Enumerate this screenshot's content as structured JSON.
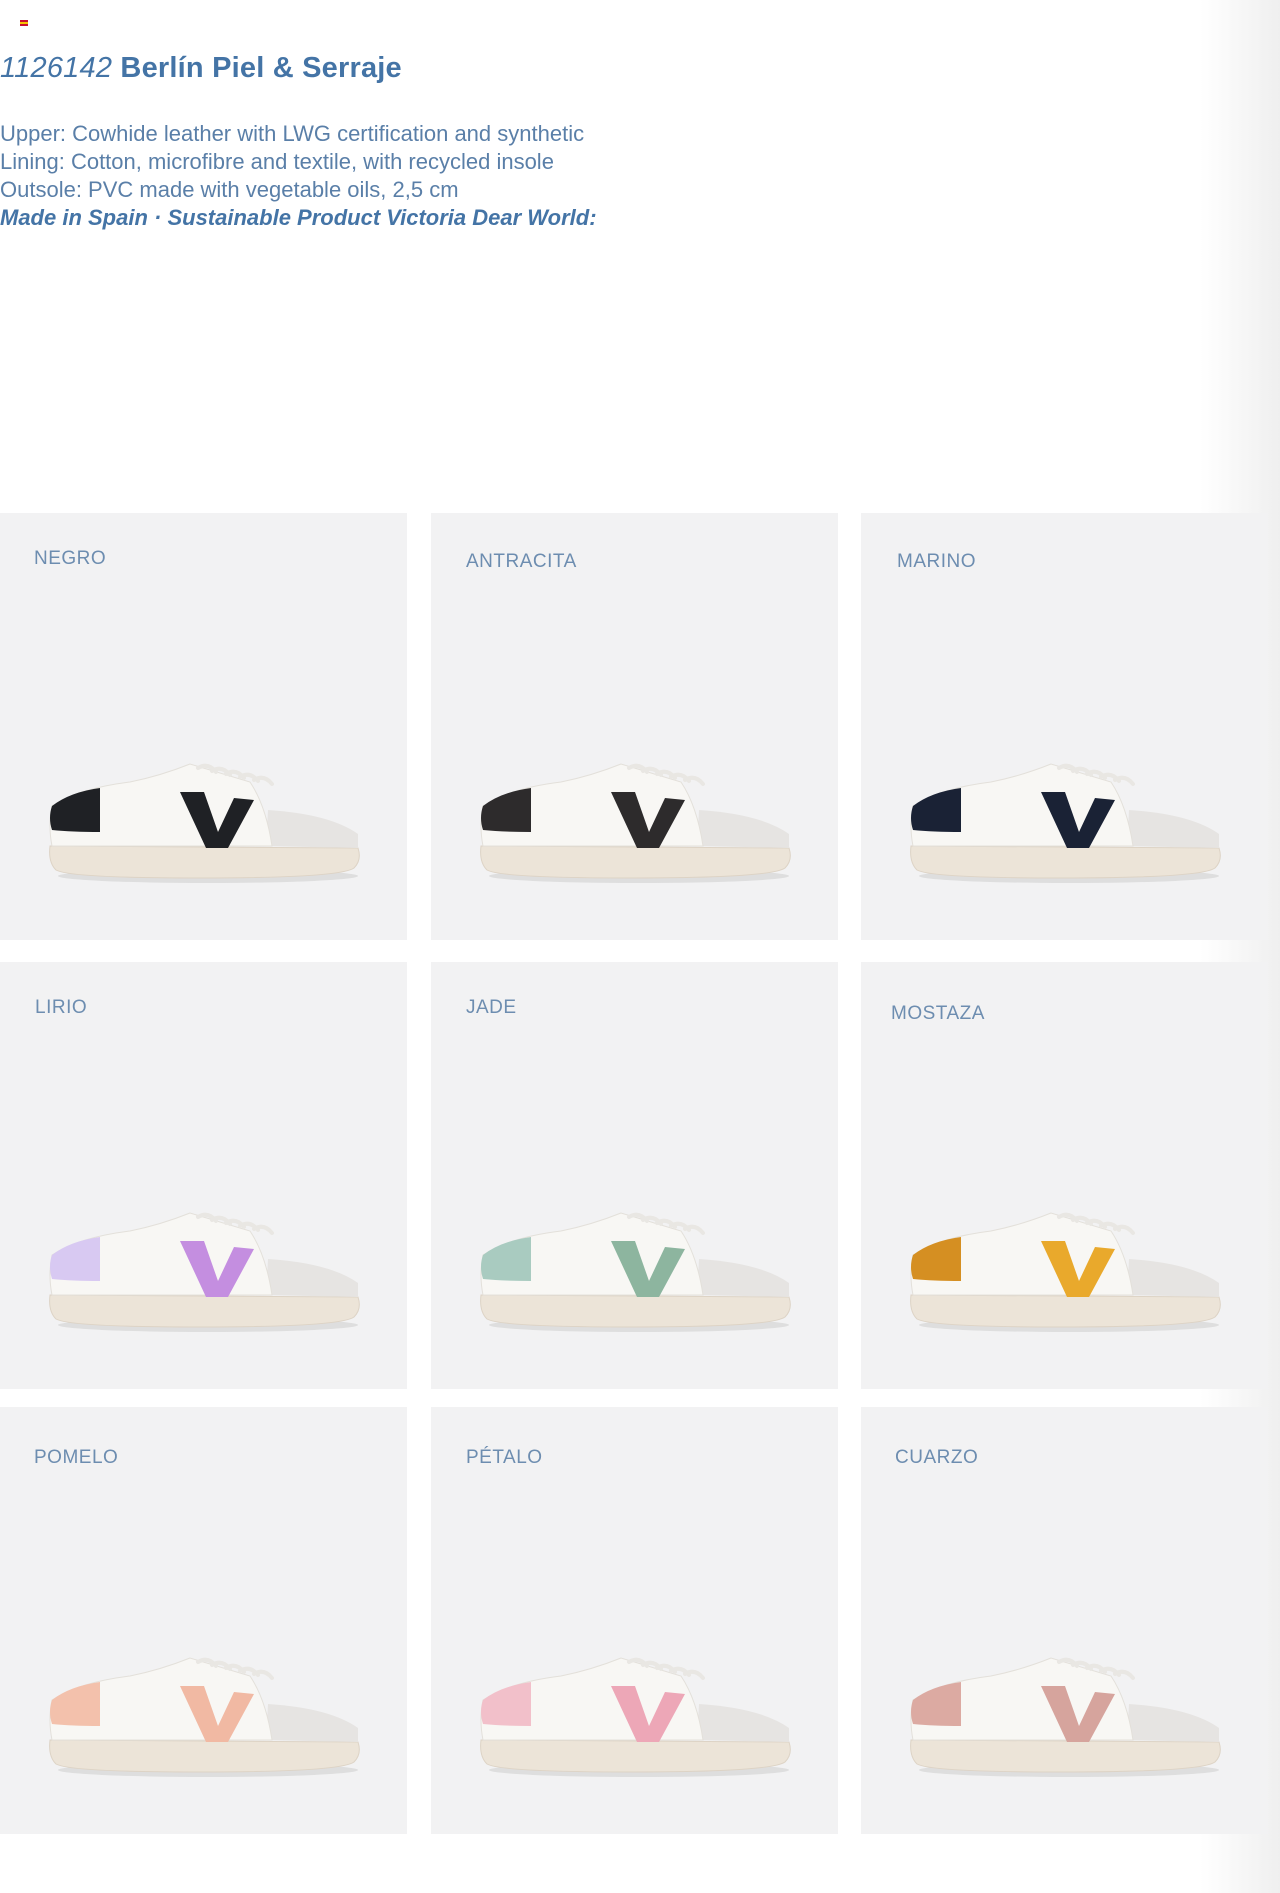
{
  "product": {
    "code": "1126142",
    "name": "Berlín Piel & Serraje",
    "specs": [
      "Upper: Cowhide leather with LWG certification and synthetic",
      "Lining: Cotton, microfibre and textile, with recycled insole",
      "Outsole: PVC made with vegetable oils, 2,5 cm"
    ],
    "tagline": "Made in Spain · Sustainable Product Victoria Dear World:"
  },
  "flag_colors": [
    "#c8102e",
    "#f5c400",
    "#c8102e"
  ],
  "variants": [
    {
      "label": "NEGRO",
      "color": "#1f2125",
      "heel": "#1f2125"
    },
    {
      "label": "ANTRACITA",
      "color": "#2d2b2c",
      "heel": "#2d2b2c"
    },
    {
      "label": "MARINO",
      "color": "#1a2235",
      "heel": "#1a2235"
    },
    {
      "label": "LIRIO",
      "color": "#c48ee0",
      "heel": "#d8c9f2"
    },
    {
      "label": "JADE",
      "color": "#8db59f",
      "heel": "#a9cbc0"
    },
    {
      "label": "MOSTAZA",
      "color": "#e9a92c",
      "heel": "#d58f22"
    },
    {
      "label": "POMELO",
      "color": "#f1b9a3",
      "heel": "#f3c1ac"
    },
    {
      "label": "PÉTALO",
      "color": "#eda7b7",
      "heel": "#f2c0ca"
    },
    {
      "label": "CUARZO",
      "color": "#d6a49d",
      "heel": "#dcaaa2"
    }
  ]
}
